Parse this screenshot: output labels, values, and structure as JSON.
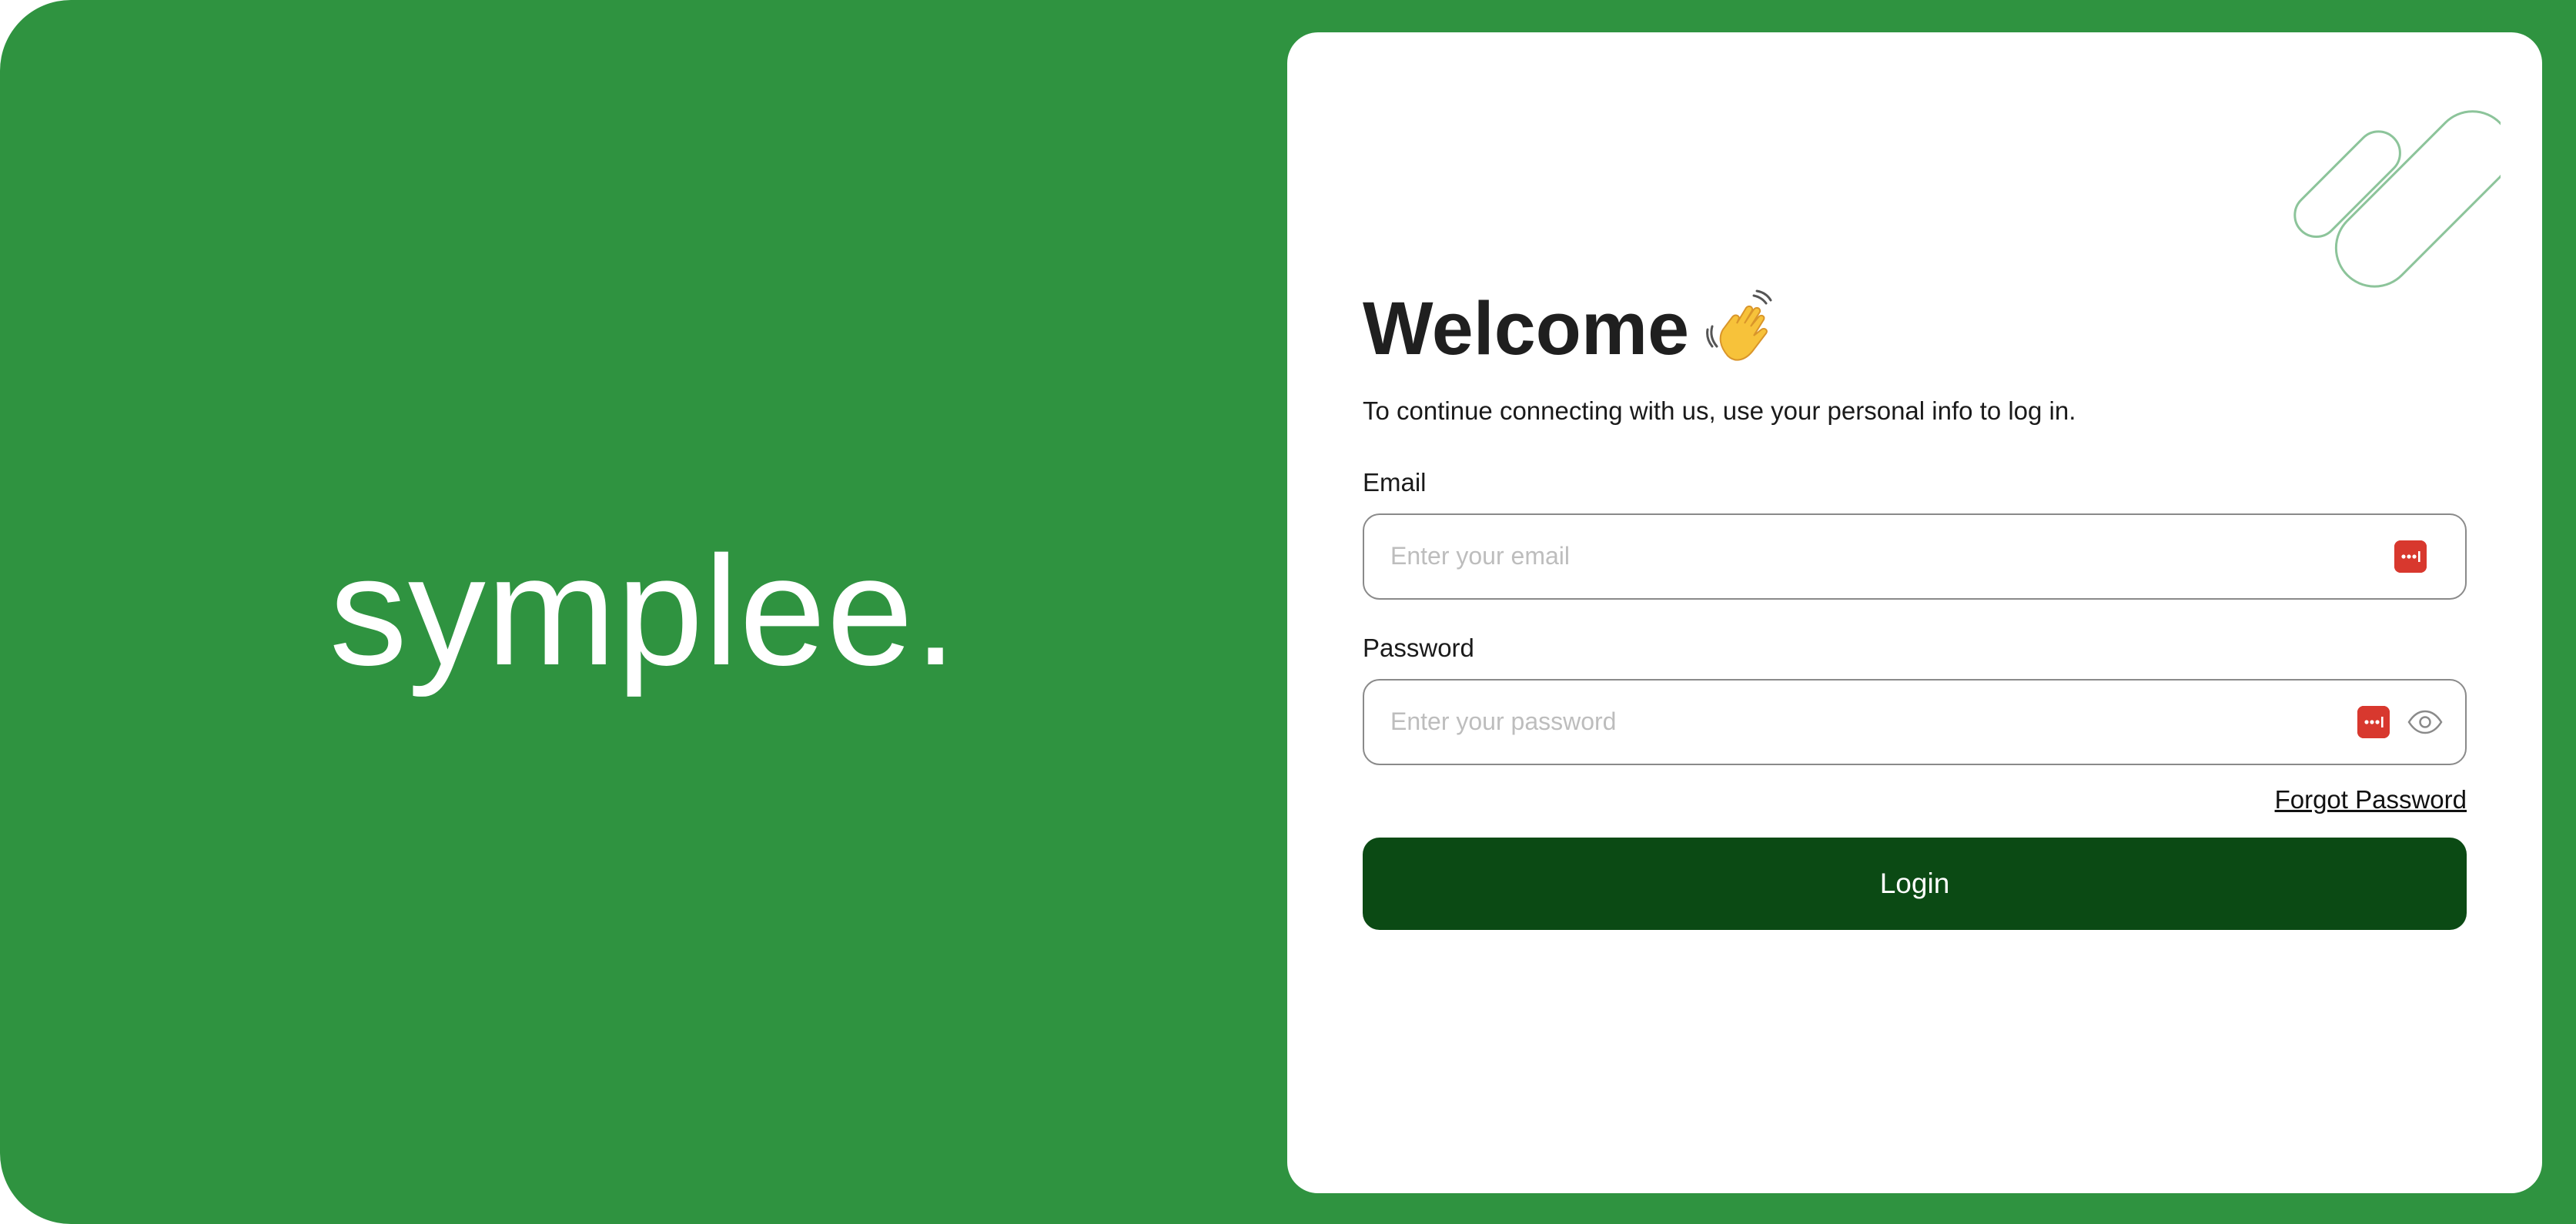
{
  "brand": {
    "logo_text": "symplee."
  },
  "login_card": {
    "title": "Welcome",
    "subtitle": "To continue connecting with us, use your personal info to log in.",
    "email": {
      "label": "Email",
      "placeholder": "Enter your email",
      "value": ""
    },
    "password": {
      "label": "Password",
      "placeholder": "Enter your password",
      "value": ""
    },
    "forgot_password_label": "Forgot Password",
    "login_label": "Login"
  },
  "icons": {
    "title_icon": "waving-hand-icon",
    "password_manager_icon": "password-manager-icon",
    "toggle_visibility_icon": "eye-icon",
    "decoration": "pill-shapes-decoration"
  },
  "colors": {
    "brand_green": "#2f9340",
    "button_dark_green": "#0b4a14",
    "card_background": "#ffffff",
    "password_manager_red": "#d8382e",
    "decoration_stroke": "#8cc49a"
  }
}
